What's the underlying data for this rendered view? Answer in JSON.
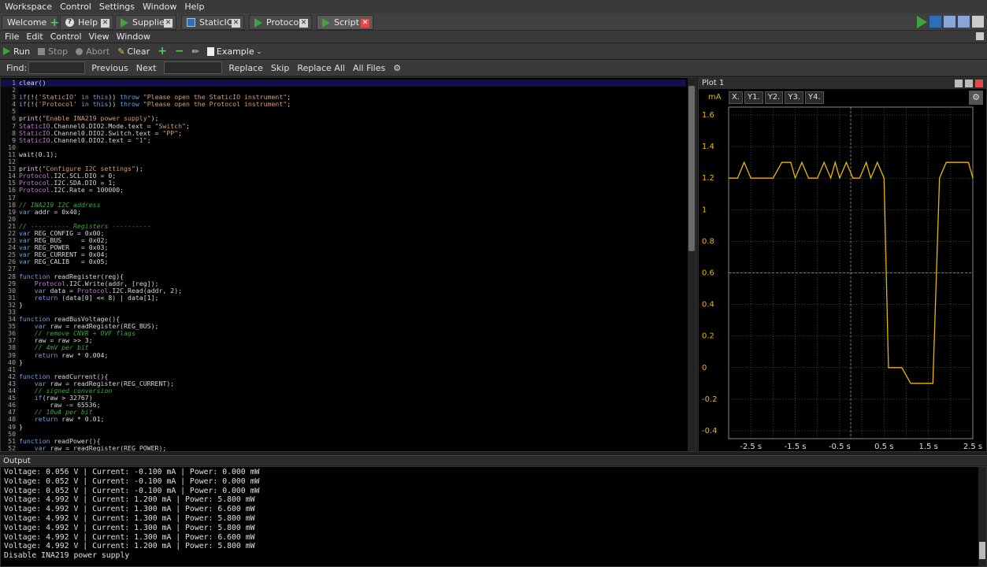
{
  "app_menu": [
    "Workspace",
    "Control",
    "Settings",
    "Window",
    "Help"
  ],
  "tabs": [
    {
      "label": "Welcome",
      "icon": "plus-icon",
      "closable": false
    },
    {
      "label": "Help",
      "icon": "help-icon",
      "closable": true
    },
    {
      "label": "Supplies",
      "icon": "play-icon",
      "closable": true
    },
    {
      "label": "StaticIO",
      "icon": "box-icon",
      "closable": true
    },
    {
      "label": "Protocol",
      "icon": "play-icon",
      "closable": true
    },
    {
      "label": "Script",
      "icon": "play-icon",
      "closable": true,
      "active": true
    }
  ],
  "script_menu": [
    "File",
    "Edit",
    "Control",
    "View",
    "Window"
  ],
  "toolbar": {
    "run": "Run",
    "stop": "Stop",
    "abort": "Abort",
    "clear": "Clear",
    "example": "Example"
  },
  "find": {
    "find_label": "Find:",
    "find_value": "",
    "previous": "Previous",
    "next": "Next",
    "replace_value": "",
    "replace": "Replace",
    "skip": "Skip",
    "replace_all": "Replace All",
    "all_files": "All Files"
  },
  "code": [
    "clear()",
    "",
    "if(!('StaticIO' in this)) throw \"Please open the StaticIO instrument\";",
    "if(!('Protocol' in this)) throw \"Please open the Protocol instrument\";",
    "",
    "print(\"Enable INA219 power supply\");",
    "StaticIO.Channel0.DIO2.Mode.text = \"Switch\";",
    "StaticIO.Channel0.DIO2.Switch.text = \"PP\";",
    "StaticIO.Channel0.DIO2.text = \"1\";",
    "",
    "wait(0.1);",
    "",
    "print(\"Configure I2C settings\");",
    "Protocol.I2C.SCL.DIO = 0;",
    "Protocol.I2C.SDA.DIO = 1;",
    "Protocol.I2C.Rate = 100000;",
    "",
    "// INA219 I2C address",
    "var addr = 0x40;",
    "",
    "// ---------- Registers ----------",
    "var REG_CONFIG = 0x00;",
    "var REG_BUS     = 0x02;",
    "var REG_POWER   = 0x03;",
    "var REG_CURRENT = 0x04;",
    "var REG_CALIB   = 0x05;",
    "",
    "function readRegister(reg){",
    "    Protocol.I2C.Write(addr, [reg]);",
    "    var data = Protocol.I2C.Read(addr, 2);",
    "    return (data[0] << 8) | data[1];",
    "}",
    "",
    "function readBusVoltage(){",
    "    var raw = readRegister(REG_BUS);",
    "    // remove CNVR + OVF flags",
    "    raw = raw >> 3;",
    "    // 4mV per bit",
    "    return raw * 0.004;",
    "}",
    "",
    "function readCurrent(){",
    "    var raw = readRegister(REG_CURRENT);",
    "    // signed conversion",
    "    if(raw > 32767)",
    "        raw -= 65536;",
    "    // 10uA per bit",
    "    return raw * 0.01;",
    "}",
    "",
    "function readPower(){",
    "    var raw = readRegister(REG_POWER);"
  ],
  "plot": {
    "title": "Plot 1",
    "unit": "mA",
    "axis_tabs": [
      "X.",
      "Y1.",
      "Y2.",
      "Y3.",
      "Y4."
    ]
  },
  "chart_data": {
    "type": "line",
    "ylabel": "mA",
    "ylim": [
      -0.45,
      1.65
    ],
    "xlim": [
      -3,
      2.5
    ],
    "y_ticks": [
      -0.4,
      -0.2,
      0,
      0.2,
      0.4,
      0.6,
      0.8,
      1,
      1.2,
      1.4,
      1.6
    ],
    "y_tick_labels": [
      "-0.4",
      "-0.2",
      "0",
      "0.2",
      "0.4",
      "0.6",
      "0.8",
      "1",
      "1.2",
      "1.4",
      "1.6"
    ],
    "x_ticks": [
      -2.5,
      -1.5,
      -0.5,
      0.5,
      1.5,
      2.5
    ],
    "x_tick_labels": [
      "-2.5 s",
      "-1.5 s",
      "-0.5 s",
      "0.5 s",
      "1.5 s",
      "2.5 s"
    ],
    "grid": true,
    "color": "#e6b800",
    "series": [
      {
        "x": [
          -3.0,
          -2.8,
          -2.65,
          -2.5,
          -2.2,
          -2.0,
          -1.8,
          -1.6,
          -1.5,
          -1.35,
          -1.2,
          -1.0,
          -0.85,
          -0.7,
          -0.6,
          -0.5,
          -0.35,
          -0.2,
          -0.05,
          0.1,
          0.2,
          0.35,
          0.5,
          0.6,
          0.75,
          0.9,
          1.1,
          1.4,
          1.6,
          1.75,
          1.9,
          2.05,
          2.2,
          2.4,
          2.5
        ],
        "y": [
          1.2,
          1.2,
          1.3,
          1.2,
          1.2,
          1.2,
          1.3,
          1.3,
          1.2,
          1.3,
          1.2,
          1.2,
          1.3,
          1.2,
          1.3,
          1.2,
          1.3,
          1.2,
          1.2,
          1.3,
          1.2,
          1.3,
          1.2,
          0.0,
          0.0,
          0.0,
          -0.1,
          -0.1,
          -0.1,
          1.2,
          1.3,
          1.3,
          1.3,
          1.3,
          1.2
        ]
      }
    ]
  },
  "output": {
    "title": "Output",
    "lines": [
      "Voltage: 0.056 V | Current: -0.100 mA | Power: 0.000 mW",
      "Voltage: 0.052 V | Current: -0.100 mA | Power: 0.000 mW",
      "Voltage: 0.052 V | Current: -0.100 mA | Power: 0.000 mW",
      "Voltage: 4.992 V | Current: 1.200 mA | Power: 5.800 mW",
      "Voltage: 4.992 V | Current: 1.300 mA | Power: 6.600 mW",
      "Voltage: 4.992 V | Current: 1.300 mA | Power: 5.800 mW",
      "Voltage: 4.992 V | Current: 1.300 mA | Power: 5.800 mW",
      "Voltage: 4.992 V | Current: 1.300 mA | Power: 6.600 mW",
      "Voltage: 4.992 V | Current: 1.200 mA | Power: 5.800 mW",
      "Disable INA219 power supply"
    ]
  }
}
